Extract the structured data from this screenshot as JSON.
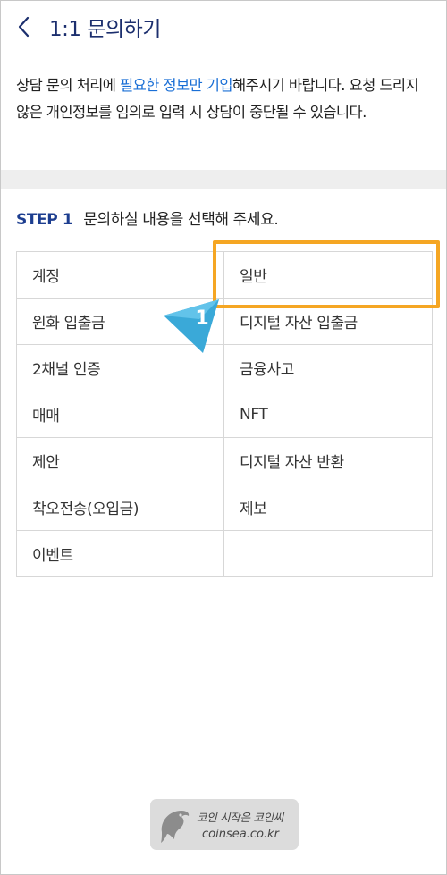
{
  "header": {
    "title": "1:1 문의하기"
  },
  "notice": {
    "part1": "상담 문의 처리에 ",
    "highlight": "필요한 정보만 기입",
    "part2": "해주시기 바랍니다. 요청 드리지 않은 개인정보를 임의로 입력 시 상담이 중단될 수 있습니다."
  },
  "step": {
    "label": "STEP 1",
    "text": "문의하실 내용을 선택해 주세요."
  },
  "categories": [
    "계정",
    "일반",
    "원화 입출금",
    "디지털 자산 입출금",
    "2채널 인증",
    "금융사고",
    "매매",
    "NFT",
    "제안",
    "디지털 자산 반환",
    "착오전송(오입금)",
    "제보",
    "이벤트",
    ""
  ],
  "annotation": {
    "number": "1",
    "highlight_color": "#f5a623",
    "callout_color": "#3aa9d8"
  },
  "watermark": {
    "title": "코인 시작은 코인씨",
    "url": "coinsea.co.kr"
  },
  "colors": {
    "title": "#1c2f6e",
    "accent_text": "#1a6fd6",
    "step_label": "#1c3d8f"
  }
}
